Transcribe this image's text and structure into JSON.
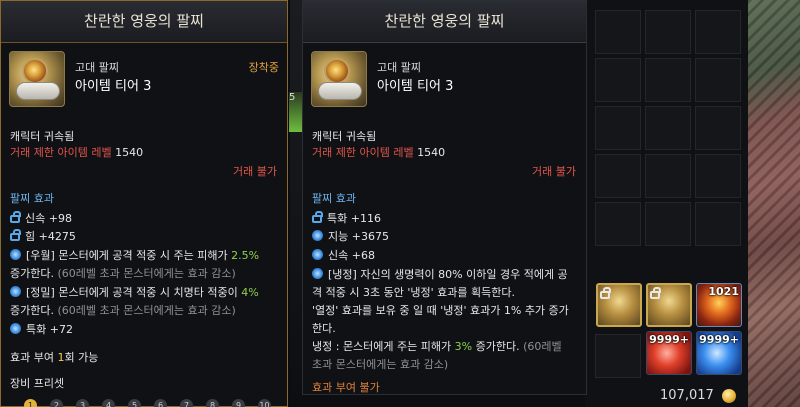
{
  "tooltips": {
    "left": {
      "title": "찬란한 영웅의 팔찌",
      "grade": "고대 팔찌",
      "tier": "아이템 티어 3",
      "equipped": "장착중",
      "bound": "캐릭터 귀속됨",
      "trade_label": "거래 제한 아이템 레벨",
      "trade_value": "1540",
      "trade_status": "거래 불가",
      "effect_header": "팔찌 효과",
      "stats": [
        {
          "label": "신속 +98",
          "icon": "lock-icon"
        },
        {
          "label": "힘 +4275",
          "icon": "lock-icon"
        }
      ],
      "special1_tag": "[우월]",
      "special1_text": "몬스터에게 공격 적중 시 주는 피해가",
      "special1_value": "2.5%",
      "special1_tail": "증가한다.",
      "special1_note": "(60레벨 초과 몬스터에게는 효과 감소)",
      "special2_tag": "[정밀]",
      "special2_text": "몬스터에게 공격 적중 시 치명타 적중이",
      "special2_value": "4%",
      "special2_tail": "증가한다.",
      "special2_note": "(60레벨 초과 몬스터에게는 효과 감소)",
      "special3": "특화 +72",
      "grant_prefix": "효과 부여",
      "grant_count": "1",
      "grant_suffix": "회 가능",
      "preset_header": "장비 프리셋",
      "presets": [
        "1",
        "2",
        "3",
        "4",
        "5",
        "6",
        "7",
        "8",
        "9",
        "10"
      ]
    },
    "right": {
      "title": "찬란한 영웅의 팔찌",
      "grade": "고대 팔찌",
      "tier": "아이템 티어 3",
      "bound": "캐릭터 귀속됨",
      "trade_label": "거래 제한 아이템 레벨",
      "trade_value": "1540",
      "trade_status": "거래 불가",
      "effect_header": "팔찌 효과",
      "stats": [
        {
          "label": "특화 +116",
          "icon": "lock-icon"
        },
        {
          "label": "지능 +3675",
          "icon": "circle-icon"
        },
        {
          "label": "신속 +68",
          "icon": "circle-icon"
        }
      ],
      "special_tag": "[냉정]",
      "special_line1": "자신의 생명력이 80% 이하일 경우 적에게 공",
      "special_line2": "격 적중 시 3초 동안 '냉정' 효과를 획득한다.",
      "special_line3": "'열정' 효과를 보유 중 일 때 '냉정' 효과가 1% 추가 증가",
      "special_line4": "한다.",
      "cold_prefix": "냉정 : 몬스터에게 주는 피해가",
      "cold_value": "3%",
      "cold_suffix": "증가한다.",
      "cold_note1": "(60레벨",
      "cold_note2": "초과 몬스터에게는 효과 감소)",
      "grant_status": "효과 부여 불가"
    }
  },
  "inventory": {
    "stacks": [
      {
        "type": "gold-bracelet",
        "locked": true,
        "count": ""
      },
      {
        "type": "gold-bracelet",
        "locked": true,
        "count": ""
      },
      {
        "type": "fire-gem",
        "locked": false,
        "count": "1021"
      },
      {
        "type": "ruby-gem",
        "locked": false,
        "count": "9999+"
      },
      {
        "type": "sapphire-gem",
        "locked": false,
        "count": "9999+"
      }
    ],
    "gold": "107,017"
  },
  "side_fragment": "5"
}
